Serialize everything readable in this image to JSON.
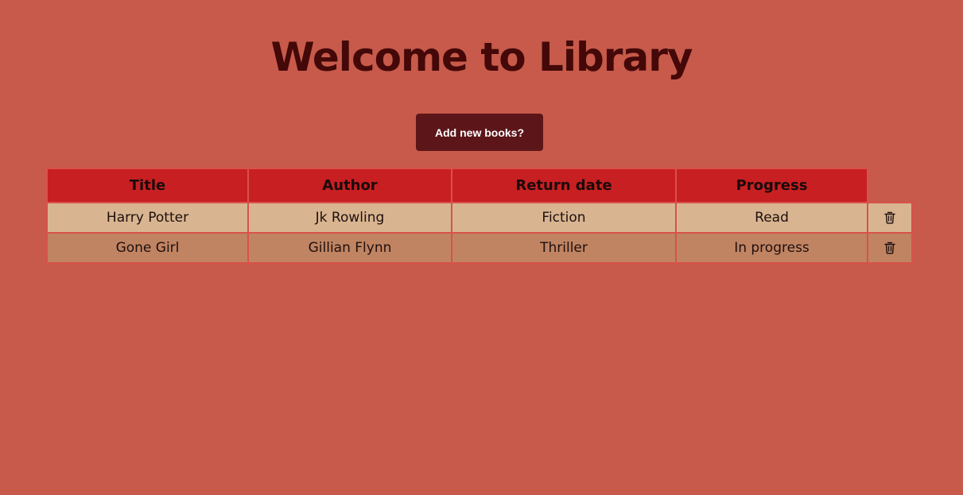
{
  "page": {
    "title": "Welcome to Library"
  },
  "actions": {
    "add_button_label": "Add new books?"
  },
  "table": {
    "headers": [
      "Title",
      "Author",
      "Return date",
      "Progress"
    ],
    "rows": [
      {
        "title": "Harry Potter",
        "author": "Jk Rowling",
        "return_date": "Fiction",
        "progress": "Read",
        "action_icon": "trash-icon"
      },
      {
        "title": "Gone Girl",
        "author": "Gillian Flynn",
        "return_date": "Thriller",
        "progress": "In progress",
        "action_icon": "trash-icon"
      }
    ]
  },
  "colors": {
    "background": "#c75a4a",
    "title_text": "#440808",
    "button_bg": "#5c161a",
    "header_bg": "#c81f22",
    "row_light": "#d8b590",
    "row_dark": "#c08462"
  }
}
